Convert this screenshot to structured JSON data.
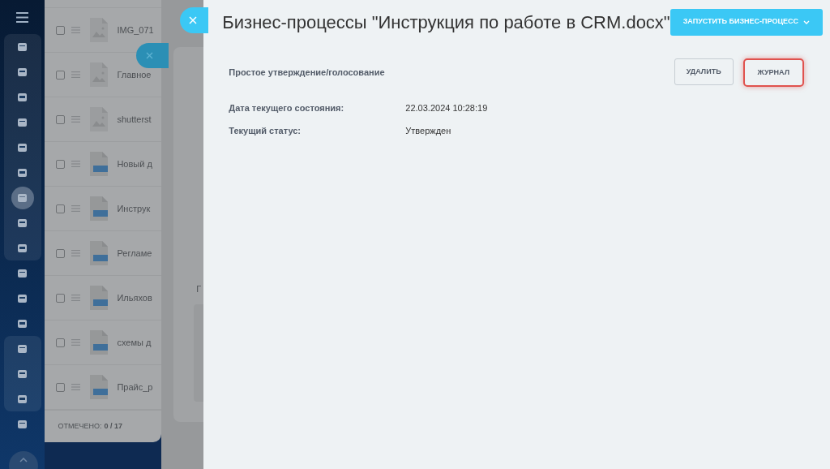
{
  "sidebar": {
    "items": [
      {
        "selected": false
      },
      {
        "selected": false
      },
      {
        "selected": false
      },
      {
        "selected": false
      },
      {
        "selected": false
      },
      {
        "selected": false
      },
      {
        "selected": true
      },
      {
        "selected": false
      },
      {
        "selected": false
      },
      {
        "selected": false
      },
      {
        "selected": false
      },
      {
        "selected": false
      },
      {
        "selected": false
      },
      {
        "selected": false
      },
      {
        "selected": false
      },
      {
        "selected": false
      }
    ]
  },
  "files": {
    "rows": [
      {
        "name": "IMG_071",
        "kind": "image",
        "checked": false
      },
      {
        "name": "Главное",
        "kind": "image",
        "checked": false
      },
      {
        "name": "shutterst",
        "kind": "image",
        "checked": false
      },
      {
        "name": "Новый д",
        "kind": "doc",
        "checked": false
      },
      {
        "name": "Инструк",
        "kind": "doc",
        "checked": false
      },
      {
        "name": "Регламе",
        "kind": "doc",
        "checked": false
      },
      {
        "name": "Ильяхов",
        "kind": "doc",
        "checked": false
      },
      {
        "name": "схемы д",
        "kind": "doc",
        "checked": false
      },
      {
        "name": "Прайс_р",
        "kind": "doc",
        "checked": false
      }
    ],
    "footer_label": "ОТМЕЧЕНО:",
    "footer_count": "0 / 17"
  },
  "middle_panel": {
    "label": "Г"
  },
  "slider": {
    "title": "Бизнес-процессы \"Инструкция по работе в CRM.docx\"",
    "start_button": "ЗАПУСТИТЬ БИЗНЕС-ПРОЦЕСС",
    "process": {
      "name": "Простое утверждение/голосование",
      "buttons": [
        {
          "label": "УДАЛИТЬ",
          "highlighted": false
        },
        {
          "label": "ЖУРНАЛ",
          "highlighted": true
        }
      ],
      "fields": [
        {
          "label": "Дата текущего состояния:",
          "value": "22.03.2024 10:28:19"
        },
        {
          "label": "Текущий статус:",
          "value": "Утвержден"
        }
      ]
    }
  }
}
